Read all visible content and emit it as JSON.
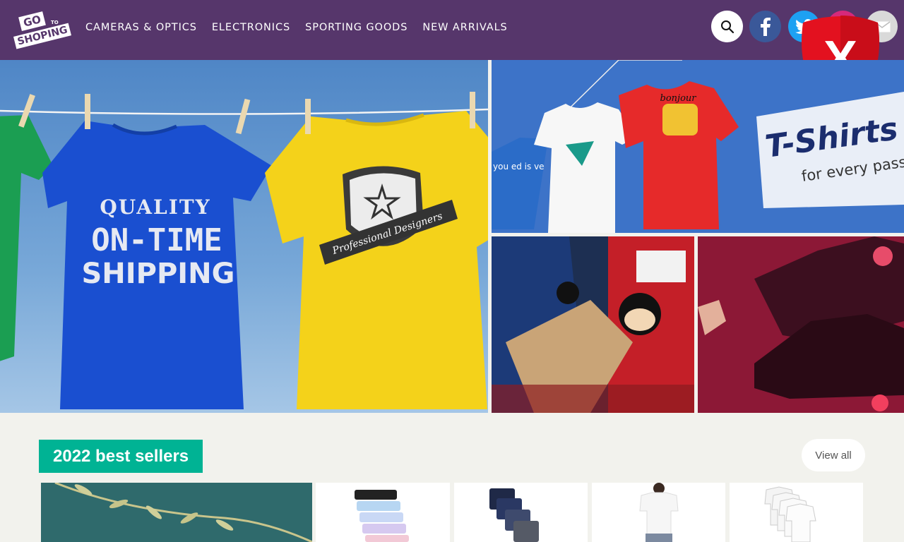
{
  "header": {
    "logo": {
      "line1": "GO",
      "line_to": "TO",
      "line2": "SHOPING"
    },
    "nav": [
      {
        "label": "CAMERAS & OPTICS"
      },
      {
        "label": "ELECTRONICS"
      },
      {
        "label": "SPORTING GOODS"
      },
      {
        "label": "NEW ARRIVALS"
      }
    ],
    "icons": [
      "search-icon",
      "facebook-icon",
      "twitter-icon",
      "instagram-icon",
      "mail-icon"
    ],
    "colors": {
      "bar": "#56366b",
      "facebook": "#3a5899",
      "twitter": "#1da1f2",
      "instagram": "#d6297b"
    }
  },
  "overlay": {
    "shield_letter": "X",
    "shield_color": "#e3111f"
  },
  "hero": {
    "main_shirts": {
      "blue_lines": [
        "QUALITY",
        "ON-TIME",
        "SHIPPING"
      ],
      "yellow_badge": "Professional Designers"
    },
    "tshirts_tile": {
      "title": "T-Shirts",
      "subtitle": "for every passi",
      "shirt_text": "bonjour",
      "side_text": "you ed is ve"
    }
  },
  "section": {
    "title": "2022 best sellers",
    "view_all": "View all",
    "accent": "#00b394"
  }
}
